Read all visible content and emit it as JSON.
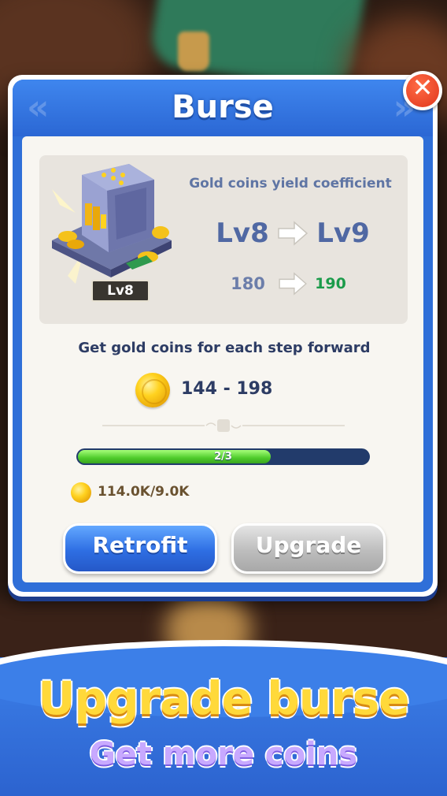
{
  "dialog": {
    "title": "Burse",
    "close_icon": "close-icon"
  },
  "upgrade_info": {
    "coefficient_label": "Gold coins yield coefficient",
    "current_level": "Lv8",
    "next_level": "Lv9",
    "current_value": "180",
    "next_value": "190",
    "badge_level": "Lv8"
  },
  "reward": {
    "label": "Get gold coins for each step forward",
    "range": "144 - 198",
    "icon": "coin-icon"
  },
  "progress": {
    "text": "2/3",
    "fraction": 0.667
  },
  "balance": {
    "text": "114.0K/9.0K",
    "icon": "coin-icon"
  },
  "buttons": {
    "retrofit": "Retrofit",
    "upgrade": "Upgrade"
  },
  "banner": {
    "title": "Upgrade burse",
    "subtitle": "Get more coins"
  },
  "colors": {
    "accent_blue": "#2f6fd8",
    "value_up_green": "#1b9b4a",
    "progress_green": "#4ecb2b",
    "coin_gold": "#ffd21f"
  }
}
